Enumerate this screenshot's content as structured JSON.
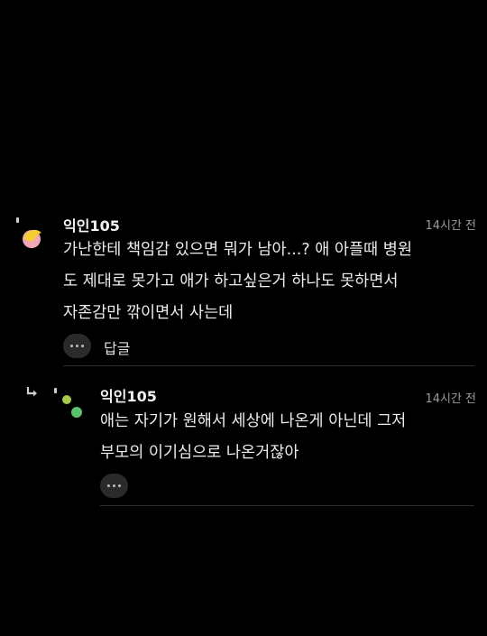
{
  "comments": [
    {
      "author": "익인105",
      "time": "14시간 전",
      "lines": [
        "가난한테 책임감 있으면 뭐가 남아...? 애 아플때 병원",
        "도 제대로 못가고 애가 하고싶은거 하나도 못하면서",
        "자존감만 깎이면서 사는데"
      ],
      "reply_label": "답글",
      "more_icon": "ellipsis-icon"
    }
  ],
  "replies": [
    {
      "author": "익인105",
      "time": "14시간 전",
      "lines": [
        "애는 자기가 원해서 세상에 나온게 아닌데 그저",
        "부모의 이기심으로 나온거잖아"
      ],
      "reply_icon": "reply-arrow-icon",
      "more_icon": "ellipsis-icon"
    }
  ],
  "colors": {
    "background": "#000000",
    "text": "#ececec",
    "muted": "#9a9a9a",
    "avatar_yellow": "#f5cf2f",
    "avatar_pink": "#f2a7b5",
    "avatar_lime": "#a8c94a",
    "avatar_green": "#59c26b"
  }
}
